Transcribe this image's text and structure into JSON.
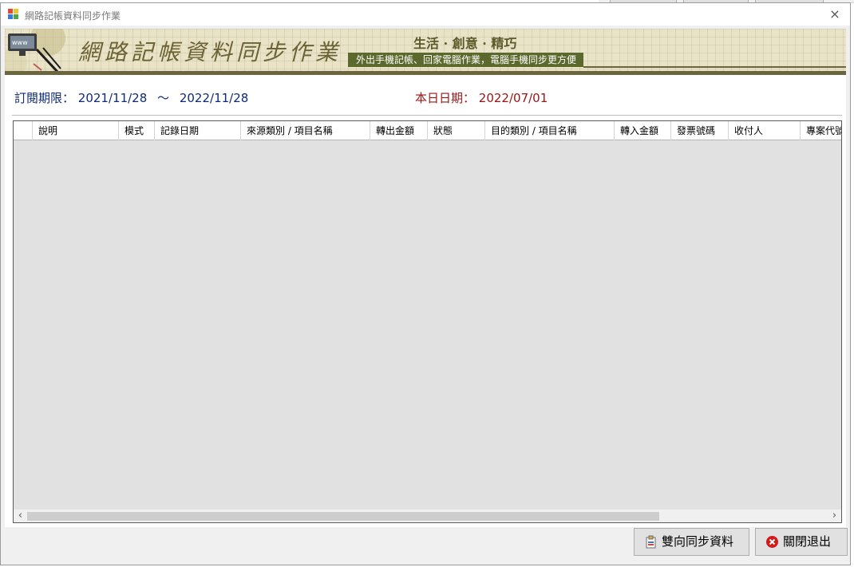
{
  "window": {
    "title": "網路記帳資料同步作業",
    "close_icon": "×"
  },
  "banner": {
    "main_title": "網路記帳資料同步作業",
    "slogan": "生活 · 創意 · 精巧",
    "subtitle": "外出手機記帳、回家電腦作業，電腦手機同步更方便",
    "decor_text": "www"
  },
  "info": {
    "period_label": "訂閱期限：",
    "period_start": "2021/11/28",
    "period_sep": "～",
    "period_end": "2022/11/28",
    "today_label": "本日日期：",
    "today_value": "2022/07/01"
  },
  "grid": {
    "columns": [
      "說明",
      "模式",
      "記錄日期",
      "來源類別 / 項目名稱",
      "轉出金額",
      "狀態",
      "目的類別 / 項目名稱",
      "轉入金額",
      "發票號碼",
      "收付人",
      "專案代號"
    ],
    "rows": [],
    "scroll_left": "‹",
    "scroll_right": "›"
  },
  "buttons": {
    "sync_label": "雙向同步資料",
    "close_label": "關閉退出"
  },
  "colors": {
    "period_text": "#0e2a7a",
    "today_text": "#9b1414",
    "banner_bg": "#e9e3c8",
    "banner_accent": "#5b6a2c",
    "close_button_icon": "#d21a1a"
  }
}
